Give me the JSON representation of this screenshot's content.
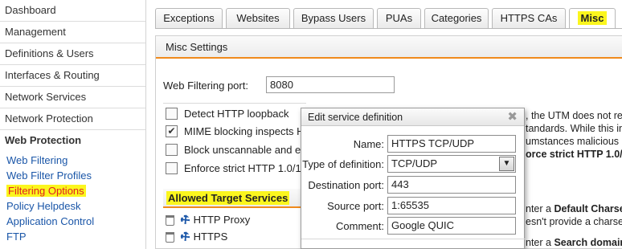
{
  "sidebar": {
    "items": [
      {
        "label": "Dashboard"
      },
      {
        "label": "Management"
      },
      {
        "label": "Definitions & Users"
      },
      {
        "label": "Interfaces & Routing"
      },
      {
        "label": "Network Services"
      },
      {
        "label": "Network Protection"
      },
      {
        "label": "Web Protection"
      }
    ],
    "sub_items": [
      {
        "label": "Web Filtering"
      },
      {
        "label": "Web Filter Profiles"
      },
      {
        "label": "Filtering Options"
      },
      {
        "label": "Policy Helpdesk"
      },
      {
        "label": "Application Control"
      },
      {
        "label": "FTP"
      }
    ]
  },
  "tabs": [
    {
      "label": "Exceptions"
    },
    {
      "label": "Websites"
    },
    {
      "label": "Bypass Users"
    },
    {
      "label": "PUAs"
    },
    {
      "label": "Categories"
    },
    {
      "label": "HTTPS CAs"
    },
    {
      "label": "Misc"
    }
  ],
  "panel": {
    "title": "Misc Settings",
    "port_label": "Web Filtering port:",
    "port_value": "8080",
    "options": [
      {
        "label": "Detect HTTP loopback",
        "checked": false
      },
      {
        "label": "MIME blocking inspects HT",
        "checked": true
      },
      {
        "label": "Block unscannable and en",
        "checked": false
      },
      {
        "label": "Enforce strict HTTP 1.0/1.1",
        "checked": false
      }
    ],
    "allowed_title": "Allowed Target Services",
    "services": [
      {
        "label": "HTTP Proxy"
      },
      {
        "label": "HTTPS"
      }
    ],
    "right_text": {
      "line1": ", the UTM does not rec",
      "line2": "tandards. While this in",
      "line3": "umstances malicious co",
      "line4": "orce strict HTTP 1.0/1.1",
      "line5_pre": "nter a ",
      "line5_bold": "Default Charset",
      "line6": "esn't provide a charset",
      "line7_pre": "nter a ",
      "line7_bold": "Search domain"
    }
  },
  "dialog": {
    "title": "Edit service definition",
    "close": "✖",
    "fields": {
      "name_label": "Name:",
      "name_value": "HTTPS TCP/UDP",
      "type_label": "Type of definition:",
      "type_value": "TCP/UDP",
      "dest_label": "Destination port:",
      "dest_value": "443",
      "src_label": "Source port:",
      "src_value": "1:65535",
      "comment_label": "Comment:",
      "comment_value": "Google QUIC"
    }
  },
  "colors": {
    "accent_orange": "#f08a1c",
    "highlight_yellow": "#fbf61e",
    "link_blue": "#1a56a8",
    "active_red": "#e02020"
  },
  "icons": {
    "delete": "trash-icon",
    "edit": "wrench-icon",
    "close": "close-icon",
    "dropdown": "chevron-down-icon"
  }
}
